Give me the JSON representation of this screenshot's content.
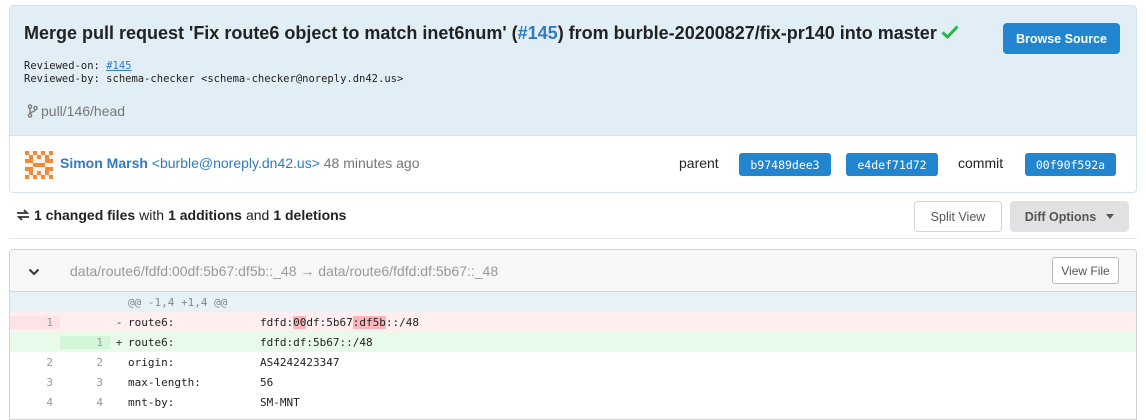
{
  "commit": {
    "title_prefix": "Merge pull request 'Fix route6 object to match inet6num' (",
    "title_pr": "#145",
    "title_suffix": ") from burble-20200827/fix-pr140 into master",
    "reviewed_on_label": "Reviewed-on: ",
    "reviewed_on_link": "#145",
    "reviewed_by_line": "Reviewed-by: schema-checker <schema-checker@noreply.dn42.us>",
    "branch": "pull/146/head",
    "browse_button": "Browse Source",
    "author_name": "Simon Marsh",
    "author_email": "<burble@noreply.dn42.us>",
    "time": "48 minutes ago",
    "parent_label": "parent",
    "parents": [
      "b97489dee3",
      "e4def71d72"
    ],
    "commit_label": "commit",
    "commit_sha": "00f90f592a",
    "verified_color": "#21ba45",
    "accent_color": "#2185d0"
  },
  "stats": {
    "changed": "1 changed files",
    "with": "with",
    "additions": "1 additions",
    "and": "and",
    "deletions": "1 deletions"
  },
  "toolbar": {
    "split_view": "Split View",
    "diff_options": "Diff Options"
  },
  "file": {
    "path": "data/route6/fdfd:00df:5b67:df5b::_48 → data/route6/fdfd:df:5b67::_48",
    "view_file": "View File",
    "hunk": "@@ -1,4 +1,4 @@",
    "lines": [
      {
        "type": "del",
        "old": "1",
        "new": "",
        "sign": "-",
        "key": "route6:",
        "value_parts": [
          "fdfd:",
          "00",
          "df:5b67",
          ":df5b",
          "::/48"
        ]
      },
      {
        "type": "add",
        "old": "",
        "new": "1",
        "sign": "+",
        "key": "route6:",
        "value": "fdfd:df:5b67::/48"
      },
      {
        "type": "ctx",
        "old": "2",
        "new": "2",
        "sign": "",
        "key": "origin:",
        "value": "AS4242423347"
      },
      {
        "type": "ctx",
        "old": "3",
        "new": "3",
        "sign": "",
        "key": "max-length:",
        "value": "56"
      },
      {
        "type": "ctx",
        "old": "4",
        "new": "4",
        "sign": "",
        "key": "mnt-by:",
        "value": "SM-MNT"
      }
    ]
  }
}
